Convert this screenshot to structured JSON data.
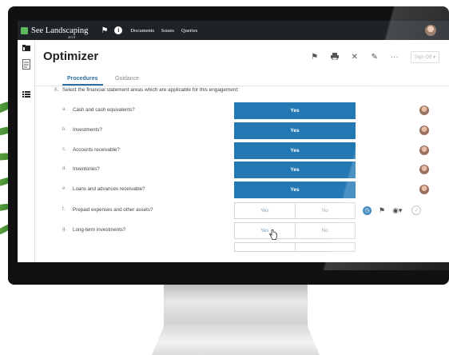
{
  "app": {
    "name": "See Landscaping",
    "year": "2018",
    "nav_links": [
      "Documents",
      "Issues",
      "Queries"
    ]
  },
  "page": {
    "title": "Optimizer",
    "sign_off_label": "Sign Off ▾"
  },
  "tabs": [
    {
      "label": "Procedures",
      "active": true
    },
    {
      "label": "Guidance",
      "active": false
    }
  ],
  "question": {
    "label": "6.",
    "text": "Select the financial statement areas which are applicable for this engagement:"
  },
  "items": [
    {
      "label": "a.",
      "text": "Cash and cash equivalents?",
      "answer": "Yes",
      "state": "selected"
    },
    {
      "label": "b.",
      "text": "Investments?",
      "answer": "Yes",
      "state": "selected"
    },
    {
      "label": "c.",
      "text": "Accounts receivable?",
      "answer": "Yes",
      "state": "selected"
    },
    {
      "label": "d.",
      "text": "Inventories?",
      "answer": "Yes",
      "state": "selected"
    },
    {
      "label": "e.",
      "text": "Loans and advances receivable?",
      "answer": "Yes",
      "state": "selected"
    },
    {
      "label": "f.",
      "text": "Prepaid expenses and other assets?",
      "yes": "Yes",
      "no": "No",
      "state": "open"
    },
    {
      "label": "g.",
      "text": "Long-term investments?",
      "yes": "Yes",
      "no": "No",
      "state": "open"
    }
  ],
  "icons": {
    "toolbar": [
      "flag-icon",
      "print-icon",
      "tools-icon",
      "edit-icon",
      "more-icon"
    ],
    "row_f": [
      "clock-icon",
      "flag-icon",
      "eye-icon",
      "check-circle-icon"
    ]
  },
  "colors": {
    "topbar": "#1f2328",
    "accent": "#2479b5",
    "logo": "#5cb85c"
  }
}
